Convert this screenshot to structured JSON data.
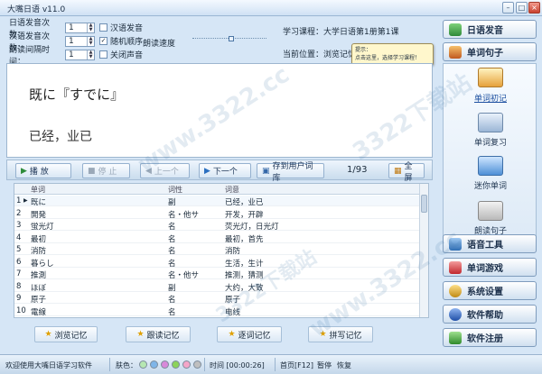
{
  "window": {
    "title": "大嘴日语 v11.0",
    "min": "–",
    "max": "□",
    "close": "×"
  },
  "settings": {
    "jp_count_label": "日语发音次数：",
    "jp_count_value": "1",
    "cn_count_label": "汉语发音次数：",
    "cn_count_value": "1",
    "interval_label": "朗读间隔时间：",
    "interval_value": "1",
    "options": [
      {
        "label": "汉语发音",
        "checked": false
      },
      {
        "label": "随机顺序",
        "checked": true
      },
      {
        "label": "关闭声音",
        "checked": false
      }
    ],
    "speed_label": "朗读速度"
  },
  "course": {
    "learning_label": "学习课程：大学日语第1册第1课",
    "position_label": "当前位置：浏览记忆",
    "tip_title": "提示：",
    "tip_text": "点击这里，选择学习课程！"
  },
  "word": {
    "japanese": "既に『すでに』",
    "chinese": "已经，业已"
  },
  "toolbar": {
    "play": "播 放",
    "stop": "停 止",
    "prev": "上一个",
    "next": "下一个",
    "save": "存到用户词库",
    "counter": "1/93",
    "fullscreen": "全屏"
  },
  "table": {
    "headers": [
      "单词",
      "词性",
      "词意"
    ],
    "rows": [
      {
        "no": "1",
        "word": "既に",
        "pos": "副",
        "meaning": "已经，业已"
      },
      {
        "no": "2",
        "word": "開発",
        "pos": "名・他サ",
        "meaning": "开发，开辟"
      },
      {
        "no": "3",
        "word": "蛍光灯",
        "pos": "名",
        "meaning": "荧光灯，日光灯"
      },
      {
        "no": "4",
        "word": "最初",
        "pos": "名",
        "meaning": "最初，首先"
      },
      {
        "no": "5",
        "word": "消防",
        "pos": "名",
        "meaning": "消防"
      },
      {
        "no": "6",
        "word": "暮らし",
        "pos": "名",
        "meaning": "生活，生计"
      },
      {
        "no": "7",
        "word": "推測",
        "pos": "名・他サ",
        "meaning": "推测，猜测"
      },
      {
        "no": "8",
        "word": "ほぼ",
        "pos": "副",
        "meaning": "大约，大致"
      },
      {
        "no": "9",
        "word": "原子",
        "pos": "名",
        "meaning": "原子"
      },
      {
        "no": "10",
        "word": "電線",
        "pos": "名",
        "meaning": "电线"
      }
    ]
  },
  "memory_buttons": [
    "浏览记忆",
    "跟读记忆",
    "逐词记忆",
    "拼写记忆"
  ],
  "status": {
    "welcome": "欢迎使用大嘴日语学习软件",
    "skin_label": "肤色：",
    "skin_colors": [
      "#b6e7b2",
      "#7fb5e8",
      "#d889d9",
      "#8cd35b",
      "#f4a6c8",
      "#bfbfbf"
    ],
    "time_label": "时间 [00:00:26]",
    "home": "首页[F12]",
    "pause": "暂停",
    "resume": "恢复"
  },
  "sidebar": {
    "japanese_pronunciation": "日语发音",
    "word_sentence": "单词句子",
    "sub_items": [
      "单词初记",
      "单词复习",
      "迷你单词",
      "朗读句子"
    ],
    "voice_tools": "语音工具",
    "word_games": "单词游戏",
    "system_settings": "系统设置",
    "software_help": "软件帮助",
    "software_register": "软件注册"
  },
  "watermark": "3322下载站",
  "watermark_site": "www.3322.cc"
}
